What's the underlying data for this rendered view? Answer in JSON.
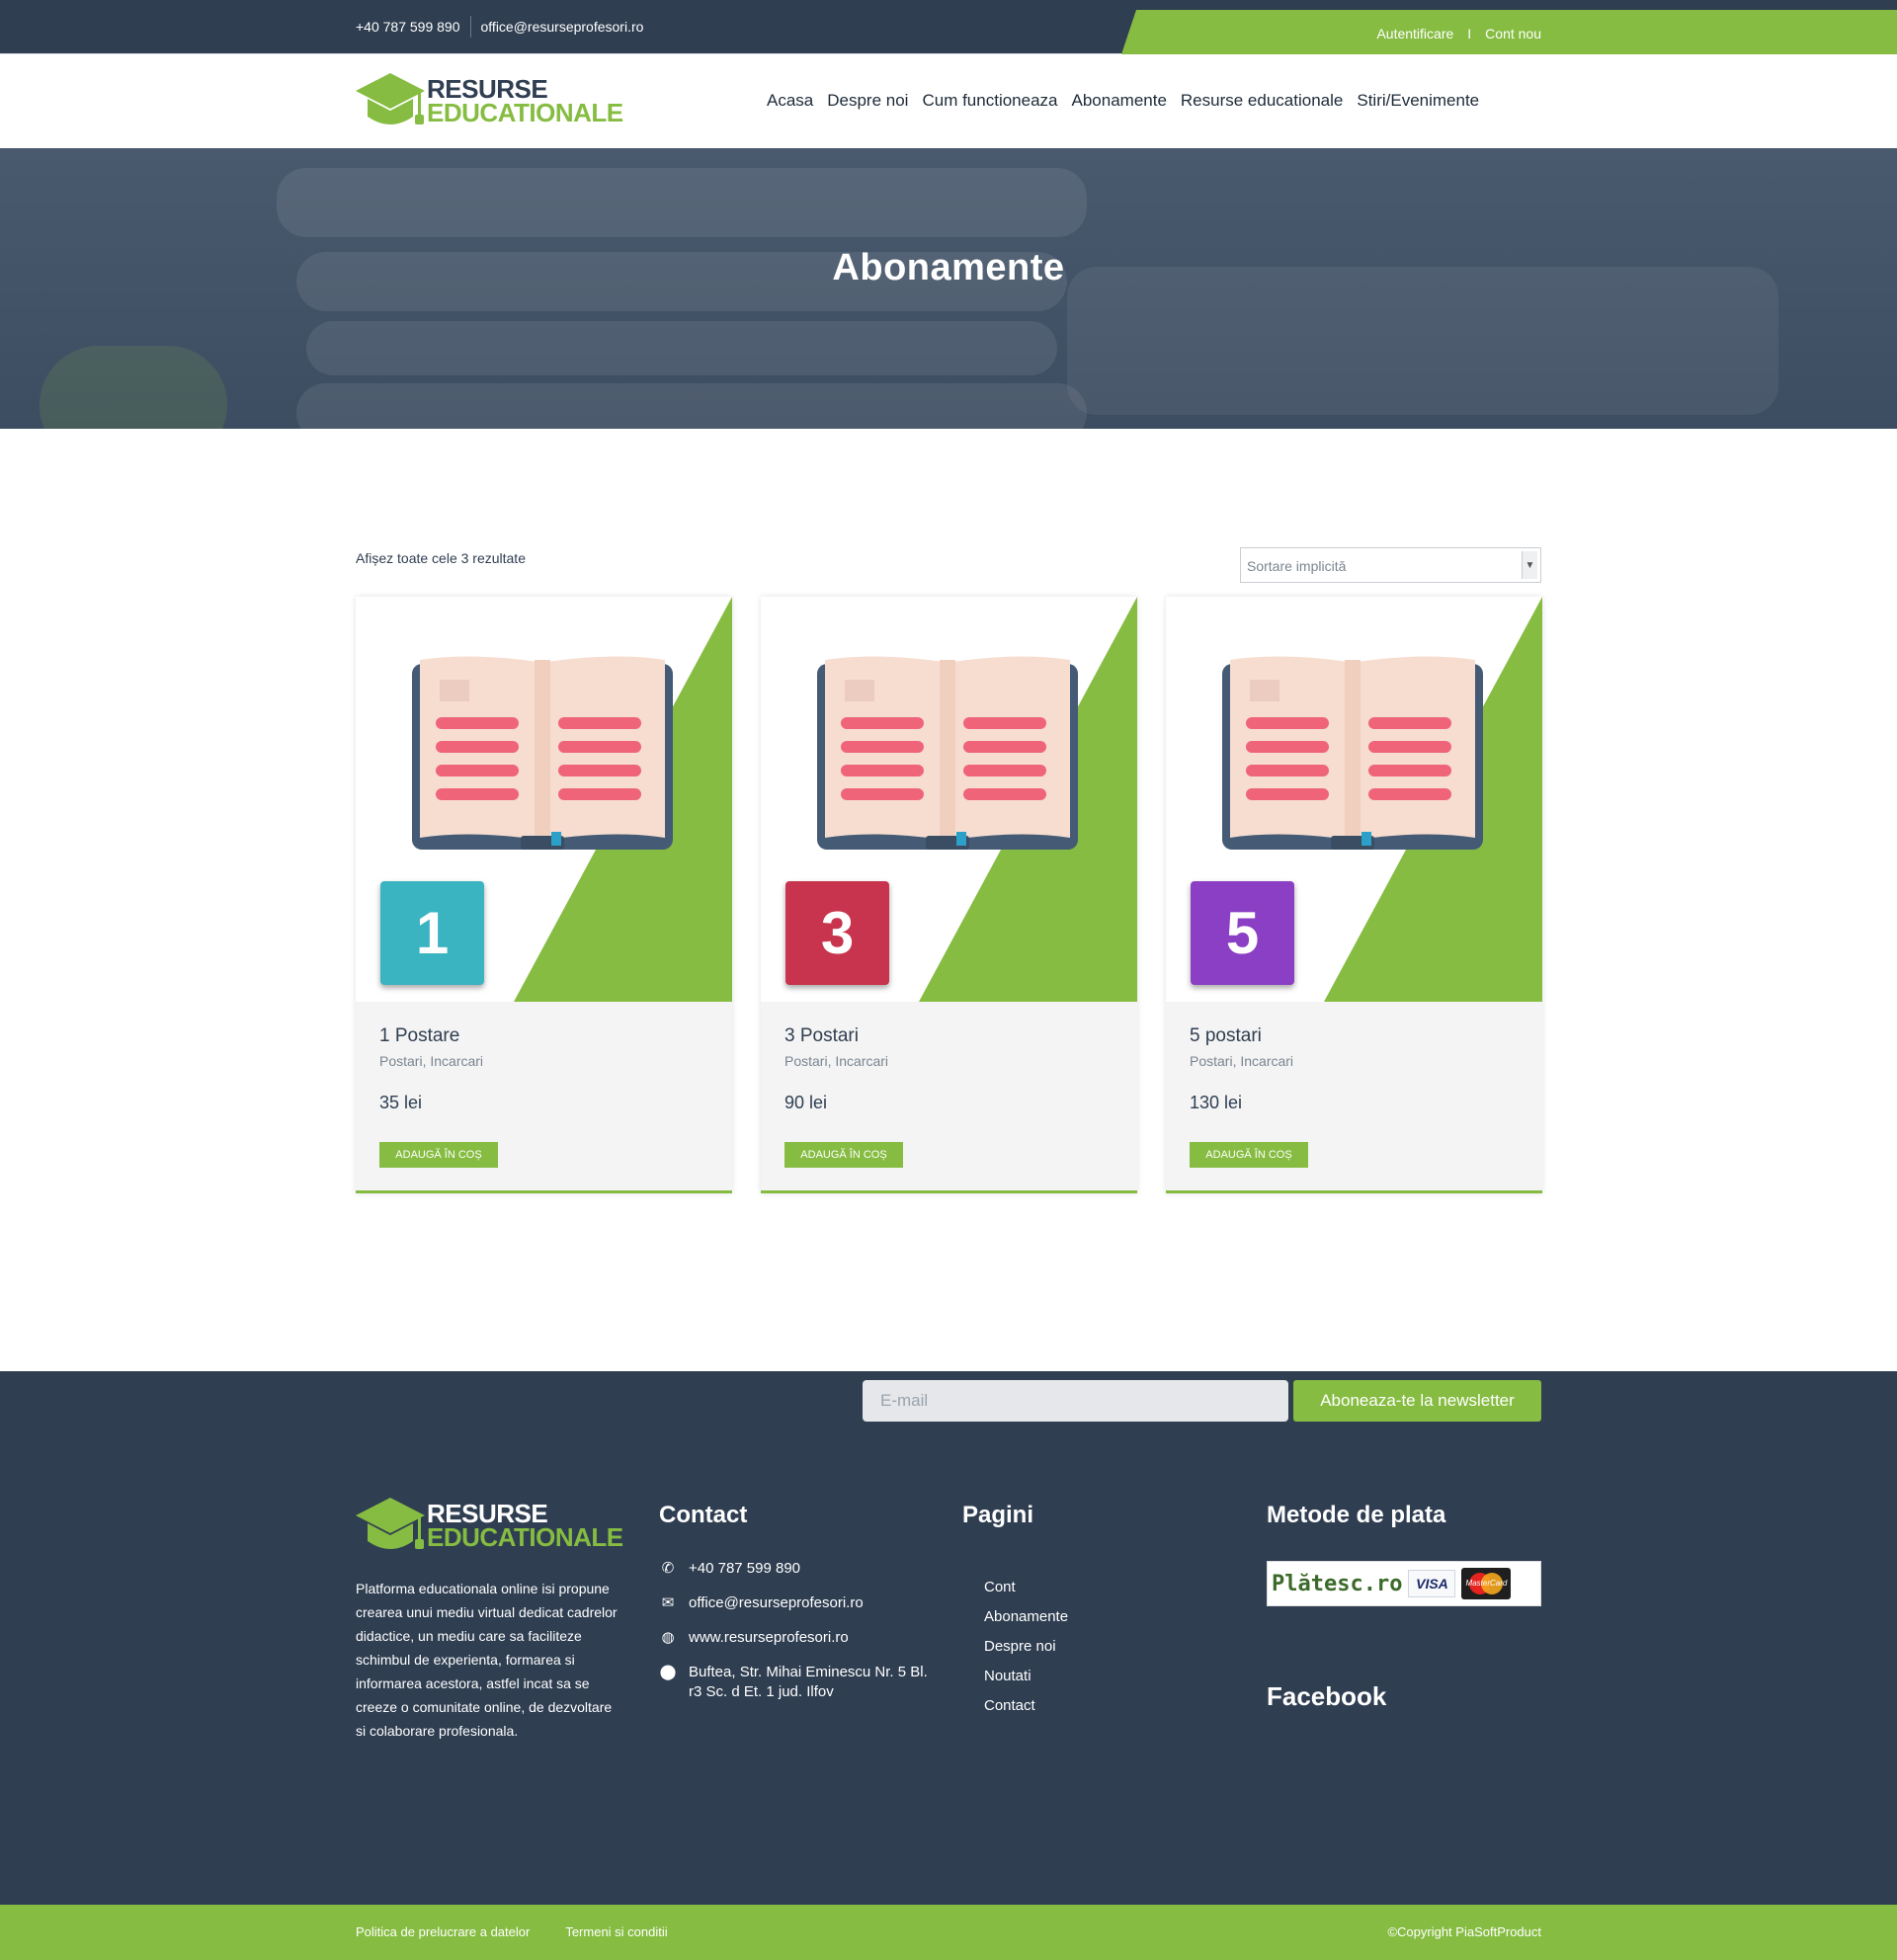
{
  "topbar": {
    "phone": "+40 787 599 890",
    "email": "office@resurseprofesori.ro",
    "login": "Autentificare",
    "separator": "I",
    "register": "Cont nou"
  },
  "brand": {
    "line1": "RESURSE",
    "line2": "EDUCATIONALE"
  },
  "nav": [
    "Acasa",
    "Despre noi",
    "Cum functioneaza",
    "Abonamente",
    "Resurse educationale",
    "Stiri/Evenimente"
  ],
  "hero": {
    "title": "Abonamente"
  },
  "listing": {
    "results_text": "Afișez toate cele 3 rezultate",
    "sort_selected": "Sortare implicită"
  },
  "products": [
    {
      "number": "1",
      "title": "1 Postare",
      "categories": "Postari, Incarcari",
      "price": "35 lei",
      "button": "ADAUGĂ ÎN COȘ",
      "badge_color": "#3bb4c1"
    },
    {
      "number": "3",
      "title": "3 Postari",
      "categories": "Postari, Incarcari",
      "price": "90 lei",
      "button": "ADAUGĂ ÎN COȘ",
      "badge_color": "#c8344d"
    },
    {
      "number": "5",
      "title": "5 postari",
      "categories": "Postari, Incarcari",
      "price": "130 lei",
      "button": "ADAUGĂ ÎN COȘ",
      "badge_color": "#8b3fc5"
    }
  ],
  "newsletter": {
    "placeholder": "E-mail",
    "button": "Aboneaza-te la newsletter"
  },
  "footer": {
    "about": "Platforma educationala online isi propune crearea unui mediu virtual dedicat cadrelor didactice, un mediu care sa faciliteze schimbul de experienta, formarea si informarea acestora, astfel incat sa se creeze o comunitate online, de dezvoltare si colaborare profesionala.",
    "contact_heading": "Contact",
    "contact": {
      "phone": "+40 787 599 890",
      "email": "office@resurseprofesori.ro",
      "website": "www.resurseprofesori.ro",
      "address": "Buftea, Str. Mihai Eminescu Nr. 5 Bl. r3 Sc. d Et. 1 jud. Ilfov"
    },
    "pages_heading": "Pagini",
    "pages": [
      "Cont",
      "Abonamente",
      "Despre noi",
      "Noutati",
      "Contact"
    ],
    "payment_heading": "Metode de plata",
    "payment": {
      "provider": "Plătesc.ro",
      "card1": "VISA",
      "card2": "MasterCard"
    },
    "facebook_heading": "Facebook"
  },
  "bottombar": {
    "privacy": "Politica de prelucrare a datelor",
    "terms": "Termeni si conditii",
    "copyright": "©Copyright PiaSoftProduct"
  },
  "colors": {
    "brand_green": "#86bc42",
    "navy": "#2f3e51"
  }
}
